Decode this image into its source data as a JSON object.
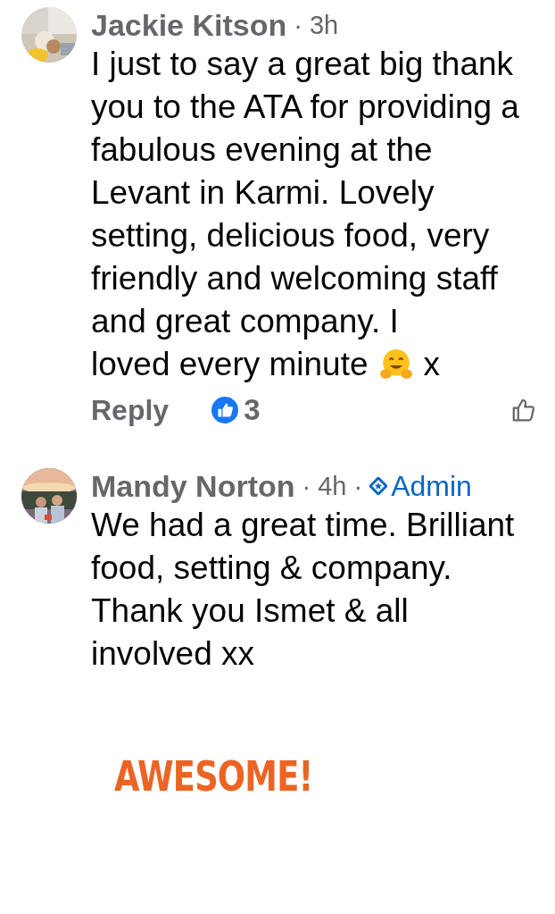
{
  "comments": [
    {
      "author": "Jackie Kitson",
      "separator": "·",
      "time": "3h",
      "text": "I just to say a great big thank you to the ATA for providing a fabulous evening at the Levant in Karmi. Lovely setting, delicious food, very friendly and welcoming staff and great company. I",
      "last_line": "loved every minute",
      "emoji_tail": "x",
      "actions": {
        "reply": "Reply",
        "like_count": "3"
      }
    },
    {
      "author": "Mandy Norton",
      "separator": "·",
      "time": "4h",
      "badge": {
        "separator": "·",
        "label": "Admin"
      },
      "text": "We had a great time. Brilliant food, setting & company. Thank you Ismet & all involved xx"
    }
  ],
  "sticker": {
    "text": "AWESOME!"
  }
}
